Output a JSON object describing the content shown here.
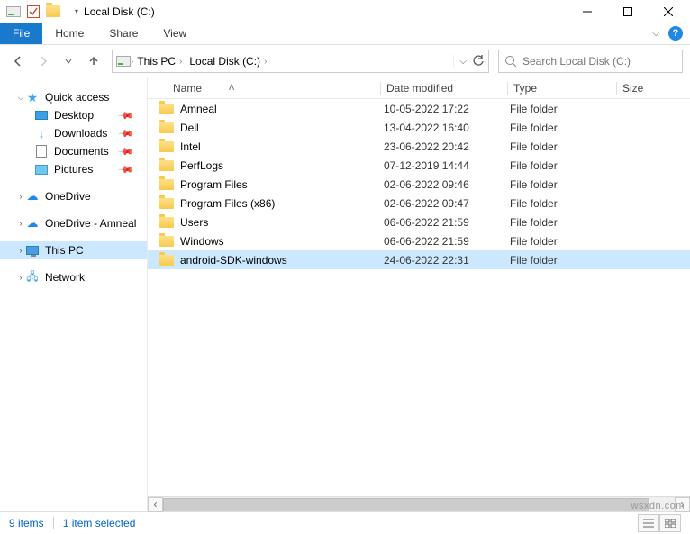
{
  "titlebar": {
    "title": "Local Disk (C:)"
  },
  "ribbon": {
    "file": "File",
    "tabs": [
      "Home",
      "Share",
      "View"
    ]
  },
  "breadcrumb": {
    "items": [
      "This PC",
      "Local Disk (C:)"
    ]
  },
  "search": {
    "placeholder": "Search Local Disk (C:)"
  },
  "sidebar": {
    "quick": {
      "label": "Quick access",
      "items": [
        {
          "label": "Desktop",
          "pinned": true
        },
        {
          "label": "Downloads",
          "pinned": true
        },
        {
          "label": "Documents",
          "pinned": true
        },
        {
          "label": "Pictures",
          "pinned": true
        }
      ]
    },
    "onedrive": {
      "label": "OneDrive"
    },
    "onedriveAmneal": {
      "label": "OneDrive - Amneal"
    },
    "thispc": {
      "label": "This PC"
    },
    "network": {
      "label": "Network"
    }
  },
  "columns": {
    "name": "Name",
    "date": "Date modified",
    "type": "Type",
    "size": "Size"
  },
  "rows": [
    {
      "name": "Amneal",
      "date": "10-05-2022 17:22",
      "type": "File folder",
      "selected": false
    },
    {
      "name": "Dell",
      "date": "13-04-2022 16:40",
      "type": "File folder",
      "selected": false
    },
    {
      "name": "Intel",
      "date": "23-06-2022 20:42",
      "type": "File folder",
      "selected": false
    },
    {
      "name": "PerfLogs",
      "date": "07-12-2019 14:44",
      "type": "File folder",
      "selected": false
    },
    {
      "name": "Program Files",
      "date": "02-06-2022 09:46",
      "type": "File folder",
      "selected": false
    },
    {
      "name": "Program Files (x86)",
      "date": "02-06-2022 09:47",
      "type": "File folder",
      "selected": false
    },
    {
      "name": "Users",
      "date": "06-06-2022 21:59",
      "type": "File folder",
      "selected": false
    },
    {
      "name": "Windows",
      "date": "06-06-2022 21:59",
      "type": "File folder",
      "selected": false
    },
    {
      "name": "android-SDK-windows",
      "date": "24-06-2022 22:31",
      "type": "File folder",
      "selected": true
    }
  ],
  "status": {
    "count": "9 items",
    "selection": "1 item selected"
  },
  "watermark": "wsxdn.com"
}
